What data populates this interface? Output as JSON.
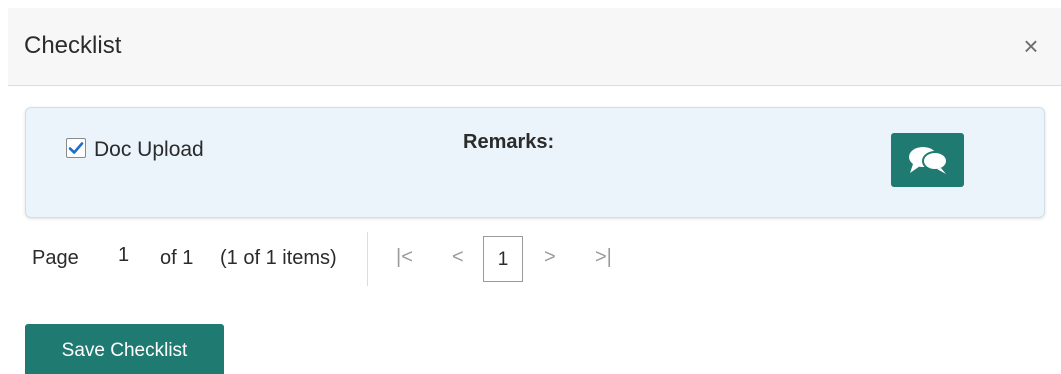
{
  "dialog": {
    "title": "Checklist",
    "close_icon": "close-icon"
  },
  "checklist": {
    "items": [
      {
        "label": "Doc Upload",
        "checked": true,
        "remarks_label": "Remarks:",
        "comment_icon": "comments-icon"
      }
    ]
  },
  "pager": {
    "page_label": "Page",
    "current_page": "1",
    "of_label": "of 1",
    "items_summary": "(1 of 1 items)",
    "first_icon": "first-page-icon",
    "prev_icon": "prev-page-icon",
    "page_number": "1",
    "next_icon": "next-page-icon",
    "last_icon": "last-page-icon"
  },
  "actions": {
    "save_label": "Save Checklist"
  },
  "colors": {
    "accent": "#1f7a72",
    "card_bg": "#eaf4fa",
    "checkbox_check": "#1e6fc9"
  }
}
